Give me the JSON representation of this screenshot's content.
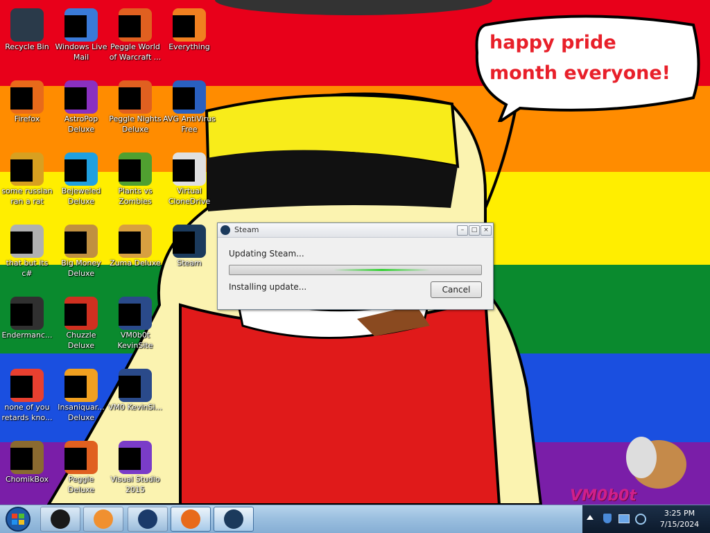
{
  "wallpaper": {
    "stripes": [
      "#e8001a",
      "#ff8c00",
      "#ffee00",
      "#0a8a2e",
      "#1a4fe0",
      "#7a1ea8"
    ],
    "speech_bubble": "happy pride month everyone!",
    "watermark": "VM0b0t"
  },
  "desktop": {
    "icons": [
      {
        "label": "Recycle Bin",
        "icon": "recycle-bin-icon",
        "col": 0,
        "row": 0
      },
      {
        "label": "Windows Live Mail",
        "icon": "mail-icon",
        "col": 1,
        "row": 0
      },
      {
        "label": "Peggle World of Warcraft ...",
        "icon": "peggle-icon",
        "col": 2,
        "row": 0
      },
      {
        "label": "Everything",
        "icon": "search-icon",
        "col": 3,
        "row": 0
      },
      {
        "label": "Firefox",
        "icon": "firefox-icon",
        "col": 0,
        "row": 1
      },
      {
        "label": "AstroPop Deluxe",
        "icon": "game-icon",
        "col": 1,
        "row": 1
      },
      {
        "label": "Peggle Nights Deluxe",
        "icon": "peggle-icon",
        "col": 2,
        "row": 1
      },
      {
        "label": "AVG AntiVirus Free",
        "icon": "antivirus-icon",
        "col": 3,
        "row": 1
      },
      {
        "label": "some russian ran a rat",
        "icon": "file-icon",
        "col": 0,
        "row": 2
      },
      {
        "label": "Bejeweled Deluxe",
        "icon": "gem-icon",
        "col": 1,
        "row": 2
      },
      {
        "label": "Plants vs Zombies",
        "icon": "plant-icon",
        "col": 2,
        "row": 2
      },
      {
        "label": "Virtual CloneDrive",
        "icon": "disc-icon",
        "col": 3,
        "row": 2
      },
      {
        "label": "that but its c#",
        "icon": "window-icon",
        "col": 0,
        "row": 3
      },
      {
        "label": "Big Money Deluxe",
        "icon": "money-icon",
        "col": 1,
        "row": 3
      },
      {
        "label": "Zuma Deluxe",
        "icon": "zuma-icon",
        "col": 2,
        "row": 3
      },
      {
        "label": "Steam",
        "icon": "steam-icon",
        "col": 3,
        "row": 3
      },
      {
        "label": "Endermanc...",
        "icon": "terminal-icon",
        "col": 0,
        "row": 4
      },
      {
        "label": "Chuzzle Deluxe",
        "icon": "chuzzle-icon",
        "col": 1,
        "row": 4
      },
      {
        "label": "VM0b0t KevinSite",
        "icon": "website-icon",
        "col": 2,
        "row": 4
      },
      {
        "label": "none of you retards kno...",
        "icon": "chrome-icon",
        "col": 0,
        "row": 5
      },
      {
        "label": "Insaniquar... Deluxe",
        "icon": "fish-icon",
        "col": 1,
        "row": 5
      },
      {
        "label": "VM0 KevinSi...",
        "icon": "website-icon",
        "col": 2,
        "row": 5
      },
      {
        "label": "ChomikBox",
        "icon": "hamster-icon",
        "col": 0,
        "row": 6
      },
      {
        "label": "Peggle Deluxe",
        "icon": "peggle-icon",
        "col": 1,
        "row": 6
      },
      {
        "label": "Visual Studio 2015",
        "icon": "visual-studio-icon",
        "col": 2,
        "row": 6
      }
    ]
  },
  "steam_dialog": {
    "title": "Steam",
    "status": "Updating Steam...",
    "substatus": "Installing update...",
    "cancel_label": "Cancel",
    "minimize_label": "–",
    "maximize_label": "□",
    "close_label": "×"
  },
  "taskbar": {
    "items": [
      {
        "icon": "media-center-icon",
        "active": false
      },
      {
        "icon": "media-player-icon",
        "active": false
      },
      {
        "icon": "app-globe-icon",
        "active": false
      },
      {
        "icon": "firefox-icon",
        "active": true
      },
      {
        "icon": "steam-icon",
        "active": true
      }
    ],
    "time": "3:25 PM",
    "date": "7/15/2024"
  }
}
